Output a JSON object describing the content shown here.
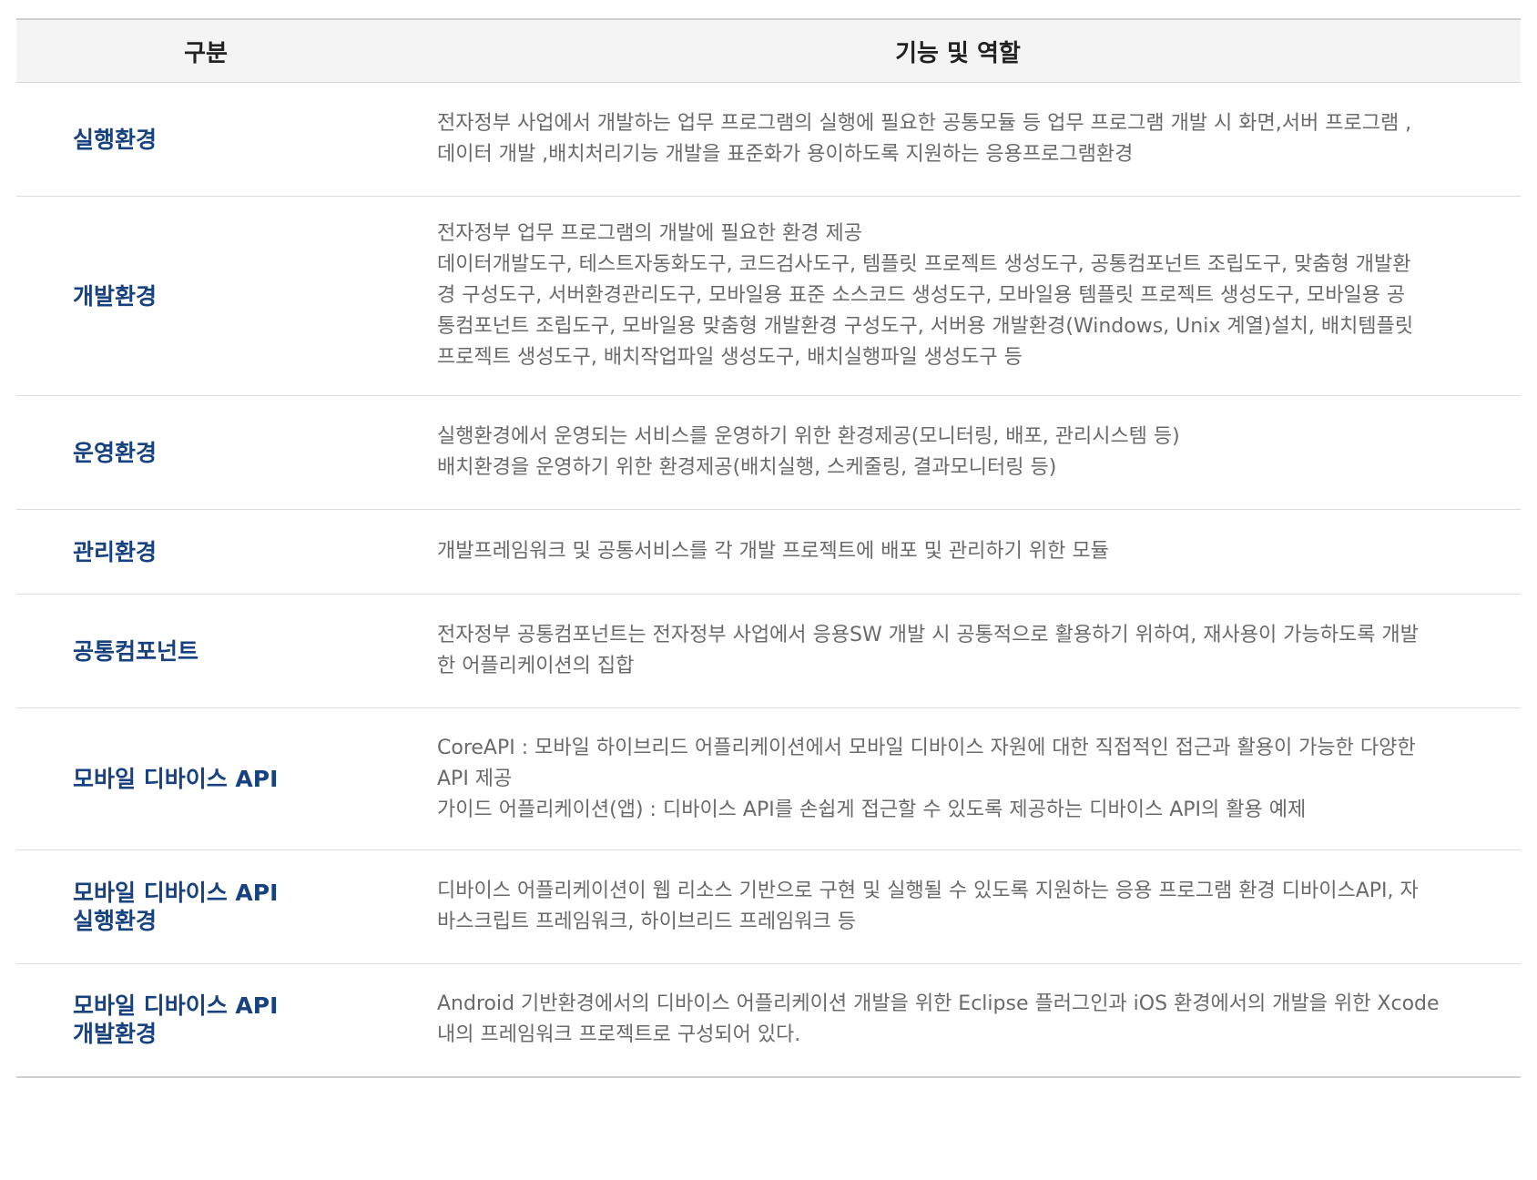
{
  "table": {
    "headers": [
      "구분",
      "기능 및 역할"
    ],
    "rows": [
      {
        "category": "실행환경",
        "description": "전자정부 사업에서 개발하는 업무 프로그램의 실행에 필요한 공통모듈 등 업무 프로그램 개발 시 화면,서버 프로그램 ,\n데이터 개발 ,배치처리기능 개발을 표준화가 용이하도록 지원하는 응용프로그램환경"
      },
      {
        "category": "개발환경",
        "description": "전자정부 업무 프로그램의 개발에 필요한 환경 제공\n데이터개발도구, 테스트자동화도구, 코드검사도구, 템플릿 프로젝트 생성도구, 공통컴포넌트 조립도구, 맞춤형 개발환\n경 구성도구, 서버환경관리도구, 모바일용 표준 소스코드 생성도구, 모바일용 템플릿 프로젝트 생성도구, 모바일용 공\n통컴포넌트 조립도구, 모바일용 맞춤형 개발환경 구성도구, 서버용 개발환경(Windows, Unix 계열)설치, 배치템플릿\n프로젝트 생성도구, 배치작업파일 생성도구, 배치실행파일 생성도구 등"
      },
      {
        "category": "운영환경",
        "description": "실행환경에서 운영되는 서비스를 운영하기 위한 환경제공(모니터링, 배포, 관리시스템 등)\n배치환경을 운영하기 위한 환경제공(배치실행, 스케줄링, 결과모니터링 등)"
      },
      {
        "category": "관리환경",
        "description": "개발프레임워크 및 공통서비스를 각 개발 프로젝트에 배포 및 관리하기 위한 모듈"
      },
      {
        "category": "공통컴포넌트",
        "description": "전자정부 공통컴포넌트는 전자정부 사업에서 응용SW 개발 시 공통적으로 활용하기 위하여, 재사용이 가능하도록 개발\n한 어플리케이션의 집합"
      },
      {
        "category": "모바일 디바이스 API",
        "description": "CoreAPI : 모바일 하이브리드 어플리케이션에서 모바일 디바이스 자원에 대한 직접적인 접근과 활용이 가능한 다양한\nAPI 제공\n가이드 어플리케이션(앱) : 디바이스 API를 손쉽게 접근할 수 있도록 제공하는 디바이스 API의 활용 예제"
      },
      {
        "category": "모바일 디바이스 API\n실행환경",
        "description": "디바이스 어플리케이션이 웹 리소스 기반으로 구현 및 실행될 수 있도록 지원하는 응용 프로그램 환경 디바이스API, 자\n바스크립트 프레임워크, 하이브리드 프레임워크 등"
      },
      {
        "category": "모바일 디바이스 API\n개발환경",
        "description": "Android 기반환경에서의 디바이스 어플리케이션 개발을 위한 Eclipse 플러그인과 iOS 환경에서의 개발을 위한 Xcode\n내의 프레임워크 프로젝트로 구성되어 있다."
      }
    ]
  }
}
